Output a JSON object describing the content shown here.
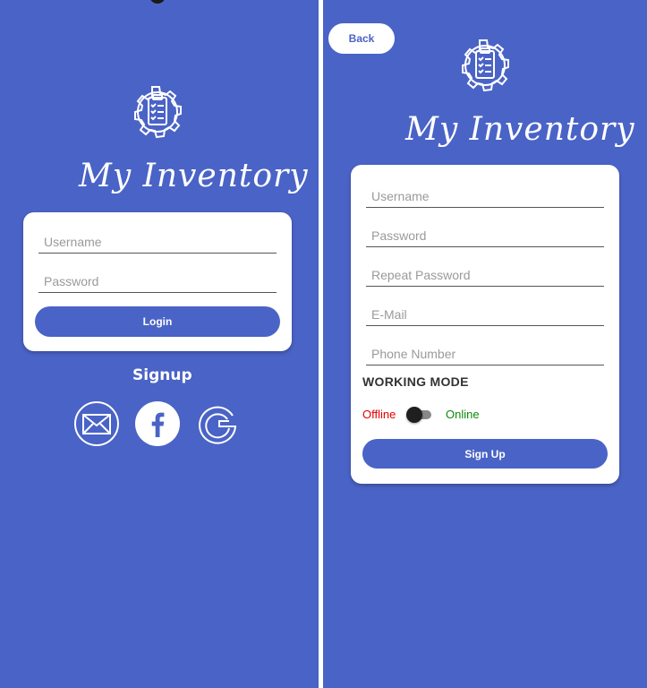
{
  "colors": {
    "background": "#4a63c6",
    "card": "#ffffff",
    "button": "#4a63c6",
    "offline": "#e00000",
    "online": "#0a8a0a"
  },
  "login_screen": {
    "app_title": "My Inventory",
    "username_placeholder": "Username",
    "password_placeholder": "Password",
    "login_label": "Login",
    "signup_label": "Signup",
    "social_icons": [
      "email-icon",
      "facebook-icon",
      "google-icon"
    ]
  },
  "signup_screen": {
    "back_label": "Back",
    "app_title": "My Inventory",
    "username_placeholder": "Username",
    "password_placeholder": "Password",
    "repeat_password_placeholder": "Repeat Password",
    "email_placeholder": "E-Mail",
    "phone_placeholder": "Phone Number",
    "working_mode_label": "WORKING MODE",
    "offline_label": "Offline",
    "online_label": "Online",
    "working_mode_online": false,
    "signup_button_label": "Sign Up"
  }
}
